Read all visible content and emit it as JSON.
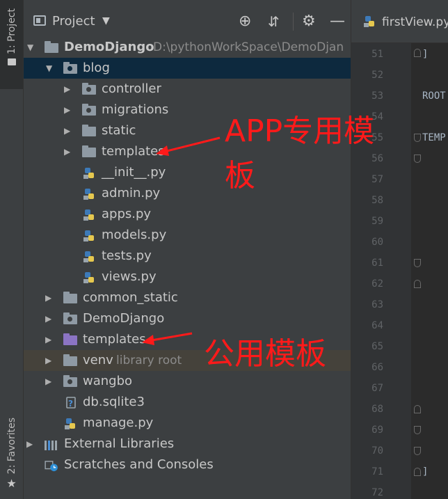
{
  "toolstrip": {
    "project_tab": "1: Project",
    "favorites_tab": "2: Favorites"
  },
  "panel": {
    "title": "Project",
    "tree": [
      {
        "label": "DemoDjango",
        "hint": "D:\\pythonWorkSpace\\DemoDjan",
        "icon": "folder-icon",
        "expand": "down"
      },
      {
        "label": "blog",
        "icon": "package-folder-icon",
        "expand": "down",
        "selected": true
      },
      {
        "label": "controller",
        "icon": "package-folder-icon",
        "expand": "right"
      },
      {
        "label": "migrations",
        "icon": "package-folder-icon",
        "expand": "right"
      },
      {
        "label": "static",
        "icon": "folder-icon",
        "expand": "right"
      },
      {
        "label": "templates",
        "icon": "folder-icon",
        "expand": "right"
      },
      {
        "label": "__init__.py",
        "icon": "python-file-icon"
      },
      {
        "label": "admin.py",
        "icon": "python-file-icon"
      },
      {
        "label": "apps.py",
        "icon": "python-file-icon"
      },
      {
        "label": "models.py",
        "icon": "python-file-icon"
      },
      {
        "label": "tests.py",
        "icon": "python-file-icon"
      },
      {
        "label": "views.py",
        "icon": "python-file-icon"
      },
      {
        "label": "common_static",
        "icon": "folder-icon",
        "expand": "right"
      },
      {
        "label": "DemoDjango",
        "icon": "package-folder-icon",
        "expand": "right"
      },
      {
        "label": "templates",
        "icon": "templates-folder-icon",
        "expand": "right"
      },
      {
        "label": "venv",
        "hint": "library root",
        "icon": "folder-icon",
        "expand": "right"
      },
      {
        "label": "wangbo",
        "icon": "package-folder-icon",
        "expand": "right"
      },
      {
        "label": "db.sqlite3",
        "icon": "unknown-file-icon"
      },
      {
        "label": "manage.py",
        "icon": "python-file-icon"
      },
      {
        "label": "External Libraries",
        "icon": "libraries-icon",
        "expand": "right"
      },
      {
        "label": "Scratches and Consoles",
        "icon": "scratches-icon"
      }
    ]
  },
  "editor": {
    "tab_label": "firstView.py",
    "line_numbers": [
      "51",
      "52",
      "53",
      "54",
      "55",
      "56",
      "57",
      "58",
      "59",
      "60",
      "61",
      "62",
      "63",
      "64",
      "65",
      "66",
      "67",
      "68",
      "69",
      "70",
      "71",
      "72"
    ],
    "code_lines": {
      "l51": "]",
      "l53": "ROOT",
      "l55": "TEMP",
      "l71": "]"
    }
  },
  "annotations": {
    "app_templates_line1": "APP专用模",
    "app_templates_line2": "板",
    "public_templates": "公用模板"
  },
  "colors": {
    "annotation": "#ff1a1a",
    "selection": "#0d293e",
    "panel_bg": "#3c3f41",
    "editor_bg": "#2b2b2b"
  }
}
